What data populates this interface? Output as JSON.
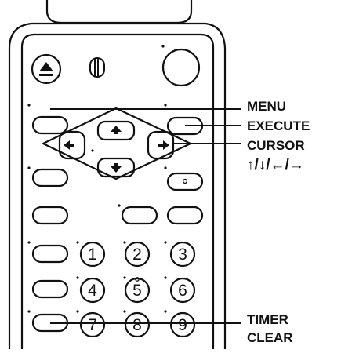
{
  "callouts": {
    "menu": "MENU",
    "execute": "EXECUTE",
    "cursor": "CURSOR",
    "cursor_arrows": "↑/↓/←/→",
    "timer": "TIMER",
    "clear": "CLEAR"
  },
  "keypad": [
    "1",
    "2",
    "3",
    "4",
    "5",
    "6",
    "7",
    "8",
    "9"
  ],
  "icons": {
    "eject": "eject-icon",
    "arrows": [
      "arrow-up-icon",
      "arrow-left-icon",
      "arrow-right-icon",
      "arrow-down-icon"
    ]
  }
}
